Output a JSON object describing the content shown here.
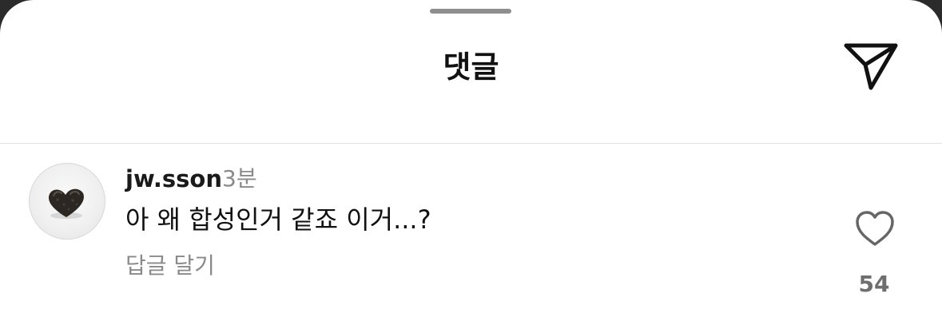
{
  "header": {
    "title": "댓글",
    "send_icon": "paper-plane-icon"
  },
  "comment": {
    "avatar_icon": "heart-shaped-food-avatar",
    "username": "jw.sson",
    "time": "3분",
    "text": "아 왜 합성인거 같죠 이거...?",
    "reply_label": "답글 달기",
    "like_icon": "heart-outline-icon",
    "like_count": "54"
  },
  "colors": {
    "text_primary": "#111111",
    "text_secondary": "#8a8a8a",
    "divider": "#e3e3e3",
    "grabber": "#8e8e8e"
  }
}
